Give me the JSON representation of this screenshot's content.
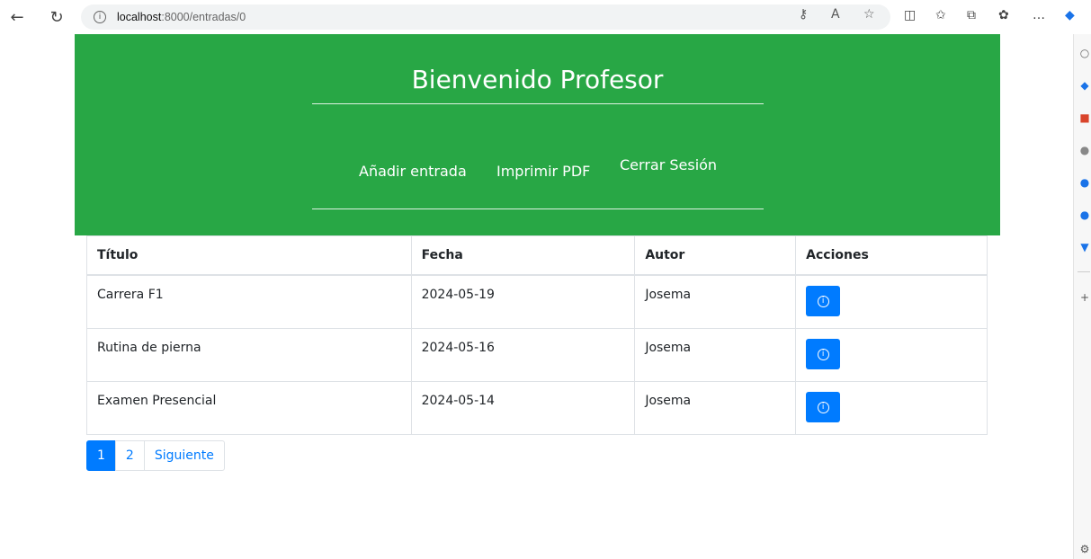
{
  "browser": {
    "url_host": "localhost",
    "url_path": ":8000/entradas/0"
  },
  "header": {
    "title": "Bienvenido Profesor",
    "nav": [
      "Añadir entrada",
      "Imprimir PDF",
      "Cerrar Sesión"
    ]
  },
  "table": {
    "headers": [
      "Título",
      "Fecha",
      "Autor",
      "Acciones"
    ],
    "rows": [
      {
        "titulo": "Carrera F1",
        "fecha": "2024-05-19",
        "autor": "Josema"
      },
      {
        "titulo": "Rutina de pierna",
        "fecha": "2024-05-16",
        "autor": "Josema"
      },
      {
        "titulo": "Examen Presencial",
        "fecha": "2024-05-14",
        "autor": "Josema"
      }
    ]
  },
  "pagination": {
    "pages": [
      "1",
      "2"
    ],
    "next": "Siguiente",
    "active": "1"
  },
  "colors": {
    "header_bg": "#28a745",
    "primary": "#007bff"
  }
}
